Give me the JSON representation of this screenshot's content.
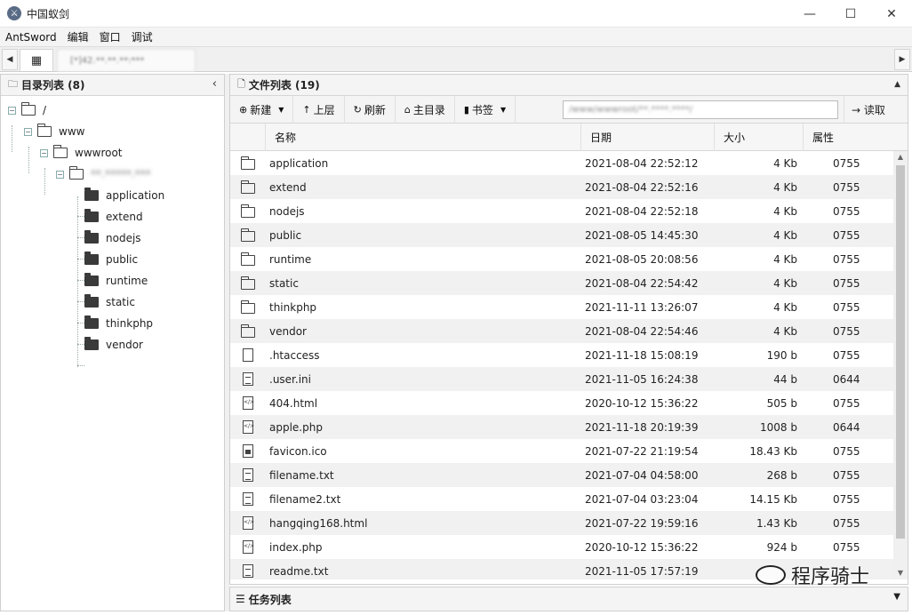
{
  "window": {
    "title": "中国蚁剑",
    "minimize": "—",
    "maximize": "☐",
    "close": "✕"
  },
  "menu": [
    "AntSword",
    "编辑",
    "窗口",
    "调试"
  ],
  "tabs": {
    "left_arrow": "◀",
    "right_arrow": "▶",
    "home_icon": "grid-icon",
    "shell_tab": "[*]42.**.**.**:***"
  },
  "directory": {
    "header": "目录列表 (8)",
    "collapse": "‹",
    "tree": {
      "root": "/",
      "www": "www",
      "wwwroot": "wwwroot",
      "site": "**.*****.***",
      "children": [
        "application",
        "extend",
        "nodejs",
        "public",
        "runtime",
        "static",
        "thinkphp",
        "vendor"
      ]
    }
  },
  "files": {
    "header": "文件列表 (19)",
    "collapse": "▲",
    "toolbar": {
      "new": "新建",
      "up": "上层",
      "refresh": "刷新",
      "home": "主目录",
      "bookmarks": "书签",
      "path": "/www/wwwroot/**.****.****/",
      "read": "读取"
    },
    "columns": [
      "名称",
      "日期",
      "大小",
      "属性"
    ],
    "rows": [
      {
        "type": "folder",
        "name": "application",
        "date": "2021-08-04 22:52:12",
        "size": "4 Kb",
        "attr": "0755"
      },
      {
        "type": "folder",
        "name": "extend",
        "date": "2021-08-04 22:52:16",
        "size": "4 Kb",
        "attr": "0755"
      },
      {
        "type": "folder",
        "name": "nodejs",
        "date": "2021-08-04 22:52:18",
        "size": "4 Kb",
        "attr": "0755"
      },
      {
        "type": "folder",
        "name": "public",
        "date": "2021-08-05 14:45:30",
        "size": "4 Kb",
        "attr": "0755"
      },
      {
        "type": "folder",
        "name": "runtime",
        "date": "2021-08-05 20:08:56",
        "size": "4 Kb",
        "attr": "0755"
      },
      {
        "type": "folder",
        "name": "static",
        "date": "2021-08-04 22:54:42",
        "size": "4 Kb",
        "attr": "0755"
      },
      {
        "type": "folder",
        "name": "thinkphp",
        "date": "2021-11-11 13:26:07",
        "size": "4 Kb",
        "attr": "0755"
      },
      {
        "type": "folder",
        "name": "vendor",
        "date": "2021-08-04 22:54:46",
        "size": "4 Kb",
        "attr": "0755"
      },
      {
        "type": "file",
        "name": ".htaccess",
        "date": "2021-11-18 15:08:19",
        "size": "190 b",
        "attr": "0755"
      },
      {
        "type": "text",
        "name": ".user.ini",
        "date": "2021-11-05 16:24:38",
        "size": "44 b",
        "attr": "0644"
      },
      {
        "type": "code",
        "name": "404.html",
        "date": "2020-10-12 15:36:22",
        "size": "505 b",
        "attr": "0755"
      },
      {
        "type": "code",
        "name": "apple.php",
        "date": "2021-11-18 20:19:39",
        "size": "1008 b",
        "attr": "0644"
      },
      {
        "type": "image",
        "name": "favicon.ico",
        "date": "2021-07-22 21:19:54",
        "size": "18.43 Kb",
        "attr": "0755"
      },
      {
        "type": "text",
        "name": "filename.txt",
        "date": "2021-07-04 04:58:00",
        "size": "268 b",
        "attr": "0755"
      },
      {
        "type": "text",
        "name": "filename2.txt",
        "date": "2021-07-04 03:23:04",
        "size": "14.15 Kb",
        "attr": "0755"
      },
      {
        "type": "code",
        "name": "hangqing168.html",
        "date": "2021-07-22 19:59:16",
        "size": "1.43 Kb",
        "attr": "0755"
      },
      {
        "type": "code",
        "name": "index.php",
        "date": "2020-10-12 15:36:22",
        "size": "924 b",
        "attr": "0755"
      },
      {
        "type": "text",
        "name": "readme.txt",
        "date": "2021-11-05 17:57:19",
        "size": "",
        "attr": ""
      }
    ]
  },
  "tasks": {
    "header": "任务列表",
    "expand": "▼"
  },
  "watermark": "程序骑士"
}
